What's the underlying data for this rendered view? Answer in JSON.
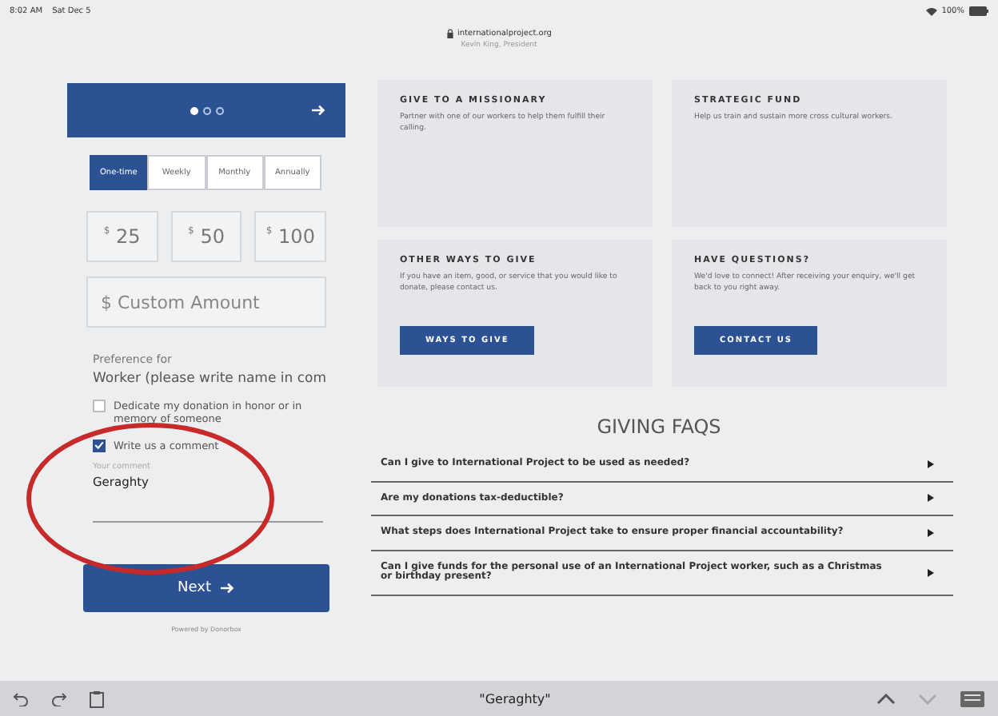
{
  "status_bar": {
    "time": "8:02 AM",
    "date": "Sat Dec 5",
    "url": "internationalproject.org",
    "subtitle": "Kevin King, President",
    "battery": "100%"
  },
  "form": {
    "steps": [
      {
        "selected": true
      },
      {
        "selected": false
      },
      {
        "selected": false
      }
    ],
    "frequencies": [
      {
        "label": "One-time",
        "selected": true
      },
      {
        "label": "Weekly",
        "selected": false
      },
      {
        "label": "Monthly",
        "selected": false
      },
      {
        "label": "Annually",
        "selected": false
      }
    ],
    "amounts": [
      {
        "currency": "$",
        "value": "25"
      },
      {
        "currency": "$",
        "value": "50"
      },
      {
        "currency": "$",
        "value": "100"
      }
    ],
    "custom_amount": {
      "placeholder": "$ Custom Amount"
    },
    "preference": {
      "label": "Preference for",
      "value": "Worker (please write name in com"
    },
    "options": [
      {
        "label": "Dedicate my donation in honor or in memory of someone",
        "checked": false
      },
      {
        "label": "Write us a comment",
        "checked": true
      }
    ],
    "comment": {
      "label": "Your comment",
      "value": "Geraghty"
    },
    "next_button": "Next",
    "powered_by": "Powered by Donorbox"
  },
  "cards": [
    {
      "title": "GIVE TO A MISSIONARY",
      "text": "Partner with one of our workers to help them fulfill their calling."
    },
    {
      "title": "STRATEGIC FUND",
      "text": "Help us train and sustain more cross cultural workers."
    },
    {
      "title": "OTHER WAYS TO GIVE",
      "text": "If you have an item, good, or service that you would like to donate, please contact us.",
      "button": "WAYS TO GIVE"
    },
    {
      "title": "HAVE QUESTIONS?",
      "text": "We'd love to connect! After receiving your enquiry, we'll get back to you right away.",
      "button": "CONTACT US"
    }
  ],
  "faq": {
    "heading": "GIVING FAQS",
    "items": [
      {
        "question": "Can I give to International Project to be used as needed?"
      },
      {
        "question": "Are my donations tax-deductible?"
      },
      {
        "question": "What steps does International Project take to ensure proper financial accountability?"
      },
      {
        "question": "Can I give funds for the personal use of an International Project worker, such as a Christmas or birthday present?"
      }
    ]
  },
  "keyboard_bar": {
    "suggestion": "\"Geraghty\""
  }
}
